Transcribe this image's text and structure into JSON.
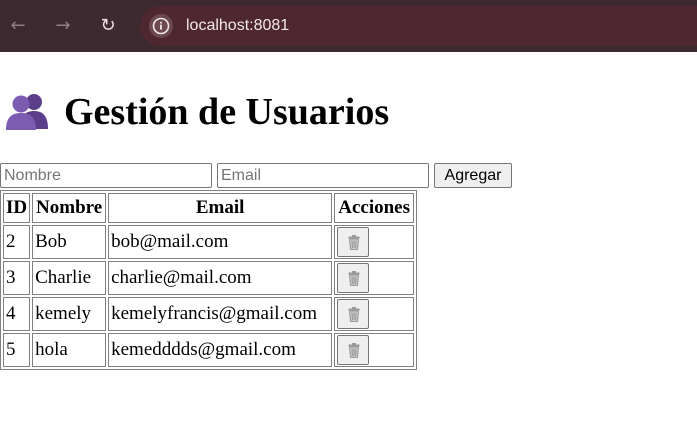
{
  "browser": {
    "url": "localhost:8081",
    "icons": [
      "back-arrow-icon",
      "forward-arrow-icon",
      "reload-icon",
      "site-info-icon"
    ]
  },
  "page": {
    "title": "Gestión de Usuarios",
    "title_icon": "two-users-icon"
  },
  "form": {
    "name_placeholder": "Nombre",
    "email_placeholder": "Email",
    "name_value": "",
    "email_value": "",
    "add_label": "Agregar"
  },
  "table": {
    "headers": [
      "ID",
      "Nombre",
      "Email",
      "Acciones"
    ],
    "rows": [
      {
        "id": "2",
        "nombre": "Bob",
        "email": "bob@mail.com",
        "action_icon": "trash-icon"
      },
      {
        "id": "3",
        "nombre": "Charlie",
        "email": "charlie@mail.com",
        "action_icon": "trash-icon"
      },
      {
        "id": "4",
        "nombre": "kemely",
        "email": "kemelyfrancis@gmail.com",
        "action_icon": "trash-icon"
      },
      {
        "id": "5",
        "nombre": "hola",
        "email": "kemedddds@gmail.com",
        "action_icon": "trash-icon"
      }
    ]
  },
  "colors": {
    "browser_frame": "#3c2a30",
    "omnibox": "#4e2730",
    "title_icon": "#6a4c9c"
  }
}
